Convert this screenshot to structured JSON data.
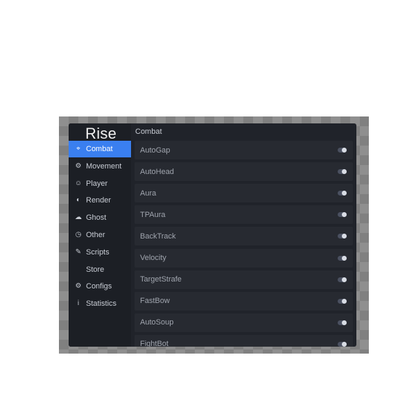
{
  "app": {
    "title": "Rise"
  },
  "header": {
    "section_title": "Combat"
  },
  "sidebar": {
    "items": [
      {
        "label": "Combat",
        "icon": "crosshair-icon",
        "active": true
      },
      {
        "label": "Movement",
        "icon": "running-icon",
        "active": false
      },
      {
        "label": "Player",
        "icon": "user-icon",
        "active": false
      },
      {
        "label": "Render",
        "icon": "eye-icon",
        "active": false
      },
      {
        "label": "Ghost",
        "icon": "ghost-icon",
        "active": false
      },
      {
        "label": "Other",
        "icon": "clock-icon",
        "active": false
      },
      {
        "label": "Scripts",
        "icon": "pen-icon",
        "active": false
      },
      {
        "label": "Store",
        "icon": "",
        "active": false
      },
      {
        "label": "Configs",
        "icon": "gears-icon",
        "active": false
      },
      {
        "label": "Statistics",
        "icon": "info-icon",
        "active": false
      }
    ]
  },
  "modules": [
    {
      "name": "AutoGap",
      "enabled": true
    },
    {
      "name": "AutoHead",
      "enabled": true
    },
    {
      "name": "Aura",
      "enabled": true
    },
    {
      "name": "TPAura",
      "enabled": true
    },
    {
      "name": "BackTrack",
      "enabled": true
    },
    {
      "name": "Velocity",
      "enabled": true
    },
    {
      "name": "TargetStrafe",
      "enabled": true
    },
    {
      "name": "FastBow",
      "enabled": true
    },
    {
      "name": "AutoSoup",
      "enabled": true
    },
    {
      "name": "FightBot",
      "enabled": true
    }
  ],
  "colors": {
    "accent": "#3a7ff0",
    "panel": "#20232a",
    "sidebar": "#1c1f25",
    "module_row": "#272a31"
  }
}
